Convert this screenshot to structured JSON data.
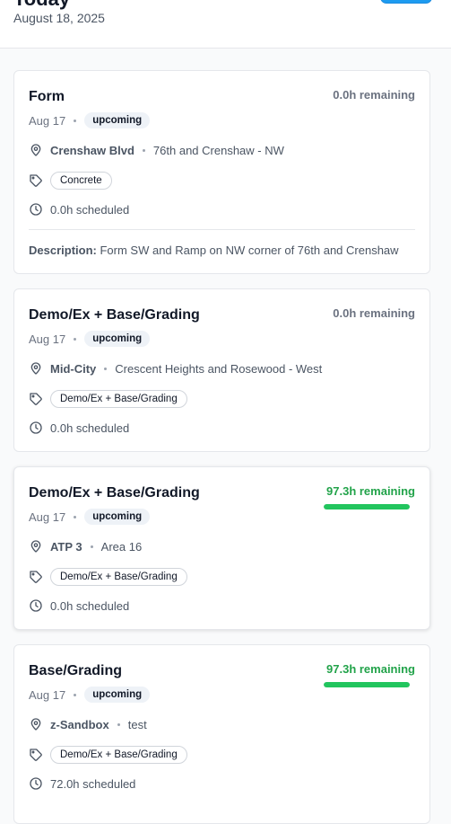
{
  "header": {
    "title": "Today",
    "date": "August 18, 2025"
  },
  "cards": [
    {
      "title": "Form",
      "remaining": "0.0h remaining",
      "date": "Aug 17",
      "status": "upcoming",
      "location_name": "Crenshaw Blvd",
      "location_detail": "76th and Crenshaw - NW",
      "tag": "Concrete",
      "scheduled": "0.0h scheduled",
      "description_label": "Description:",
      "description": "Form SW and Ramp on NW corner of 76th and Crenshaw"
    },
    {
      "title": "Demo/Ex + Base/Grading",
      "remaining": "0.0h remaining",
      "date": "Aug 17",
      "status": "upcoming",
      "location_name": "Mid-City",
      "location_detail": "Crescent Heights and Rosewood - West",
      "tag": "Demo/Ex + Base/Grading",
      "scheduled": "0.0h scheduled"
    },
    {
      "title": "Demo/Ex + Base/Grading",
      "remaining": "97.3h remaining",
      "progress": 1.0,
      "date": "Aug 17",
      "status": "upcoming",
      "location_name": "ATP 3",
      "location_detail": "Area 16",
      "tag": "Demo/Ex + Base/Grading",
      "scheduled": "0.0h scheduled"
    },
    {
      "title": "Base/Grading",
      "remaining": "97.3h remaining",
      "progress": 1.0,
      "date": "Aug 17",
      "status": "upcoming",
      "location_name": "z-Sandbox",
      "location_detail": "test",
      "tag": "Demo/Ex + Base/Grading",
      "scheduled": "72.0h scheduled"
    }
  ],
  "colors": {
    "accent_blue": "#1d9bf0",
    "progress_green": "#22c55e",
    "remaining_green": "#22a34a",
    "muted_gray": "#6b7280"
  },
  "icons": {
    "location": "map-pin-icon",
    "tag": "tag-icon",
    "time": "clock-icon"
  }
}
